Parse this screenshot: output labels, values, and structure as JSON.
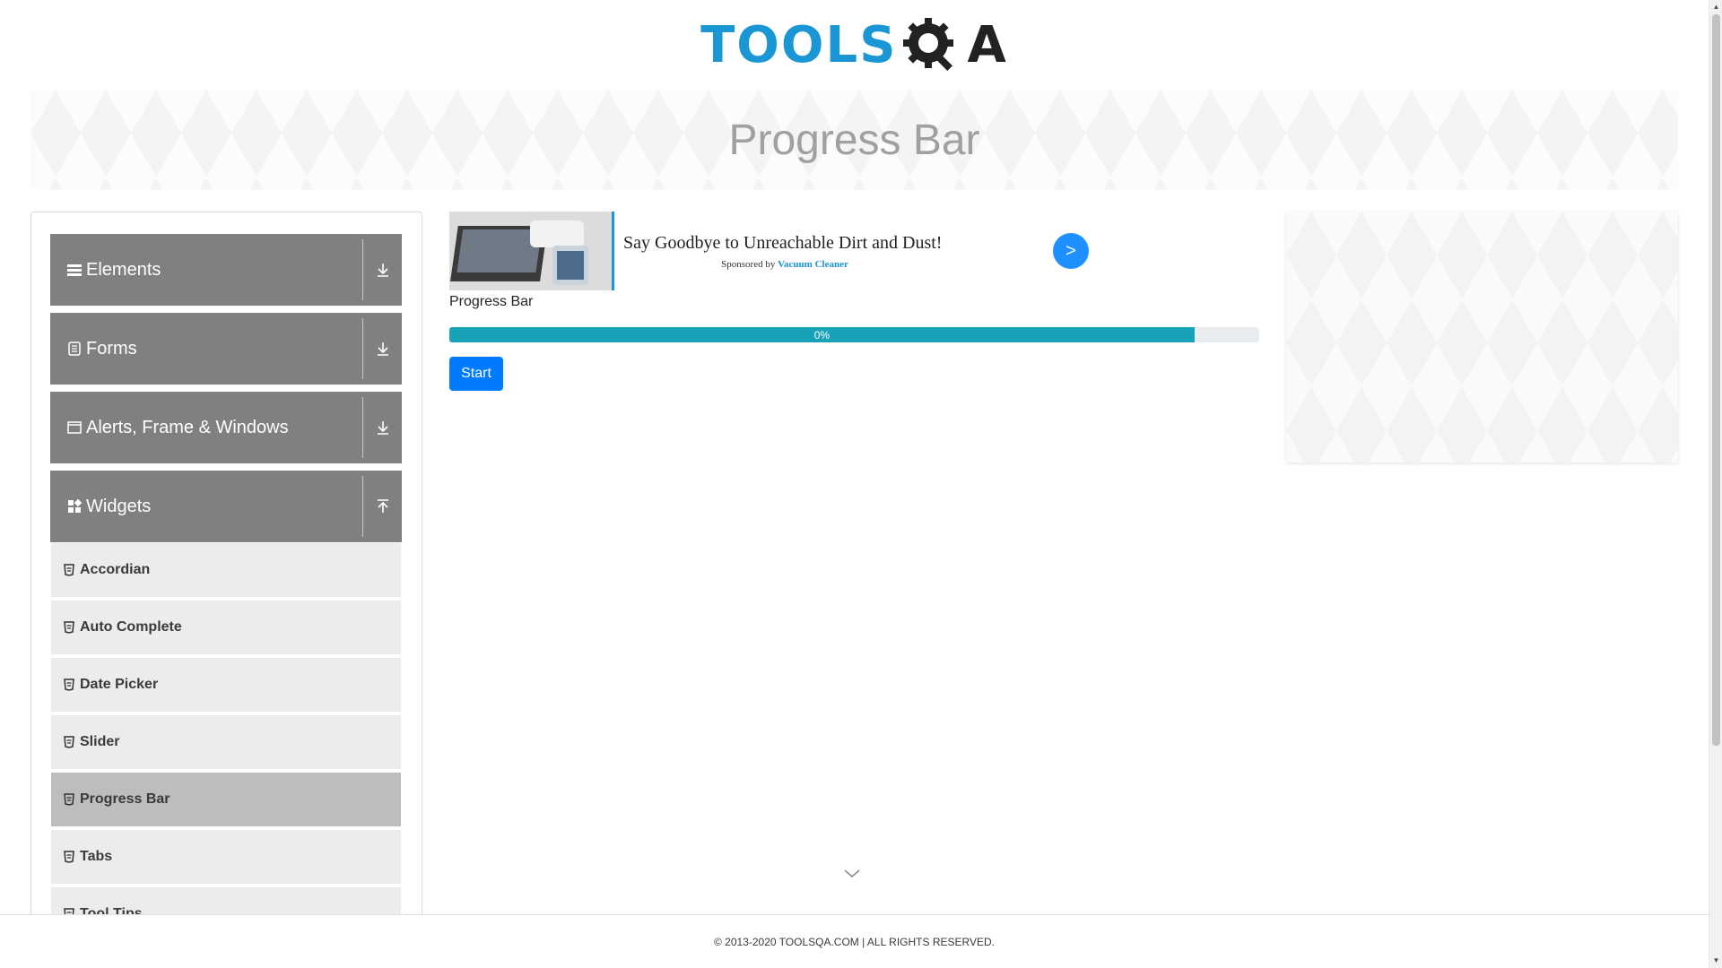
{
  "brand": {
    "logo_text": "TOOLS",
    "logo_suffix": "A",
    "color": "#1a96d5"
  },
  "banner": {
    "title": "Progress Bar"
  },
  "sidebar": {
    "groups": [
      {
        "label": "Elements",
        "icon": "hamburger-icon",
        "expanded": false
      },
      {
        "label": "Forms",
        "icon": "document-icon",
        "expanded": false
      },
      {
        "label": "Alerts, Frame & Windows",
        "icon": "window-icon",
        "expanded": false
      },
      {
        "label": "Widgets",
        "icon": "widgets-icon",
        "expanded": true
      }
    ],
    "widget_items": [
      {
        "label": "Accordian"
      },
      {
        "label": "Auto Complete"
      },
      {
        "label": "Date Picker"
      },
      {
        "label": "Slider"
      },
      {
        "label": "Progress Bar",
        "active": true
      },
      {
        "label": "Tabs"
      },
      {
        "label": "Tool Tips"
      }
    ]
  },
  "ad": {
    "title": "Say Goodbye to Unreachable Dirt and Dust!",
    "sponsor_prefix": "Sponsored by",
    "sponsor_name": "Vacuum Cleaner",
    "go_label": ">"
  },
  "progress": {
    "label": "Progress Bar",
    "text": "0%",
    "fill_fraction": 0.92,
    "color": "#17a2b8"
  },
  "start_button": {
    "label": "Start",
    "color": "#007bff"
  },
  "footer": {
    "text": "© 2013-2020 TOOLSQA.COM | ALL RIGHTS RESERVED."
  }
}
